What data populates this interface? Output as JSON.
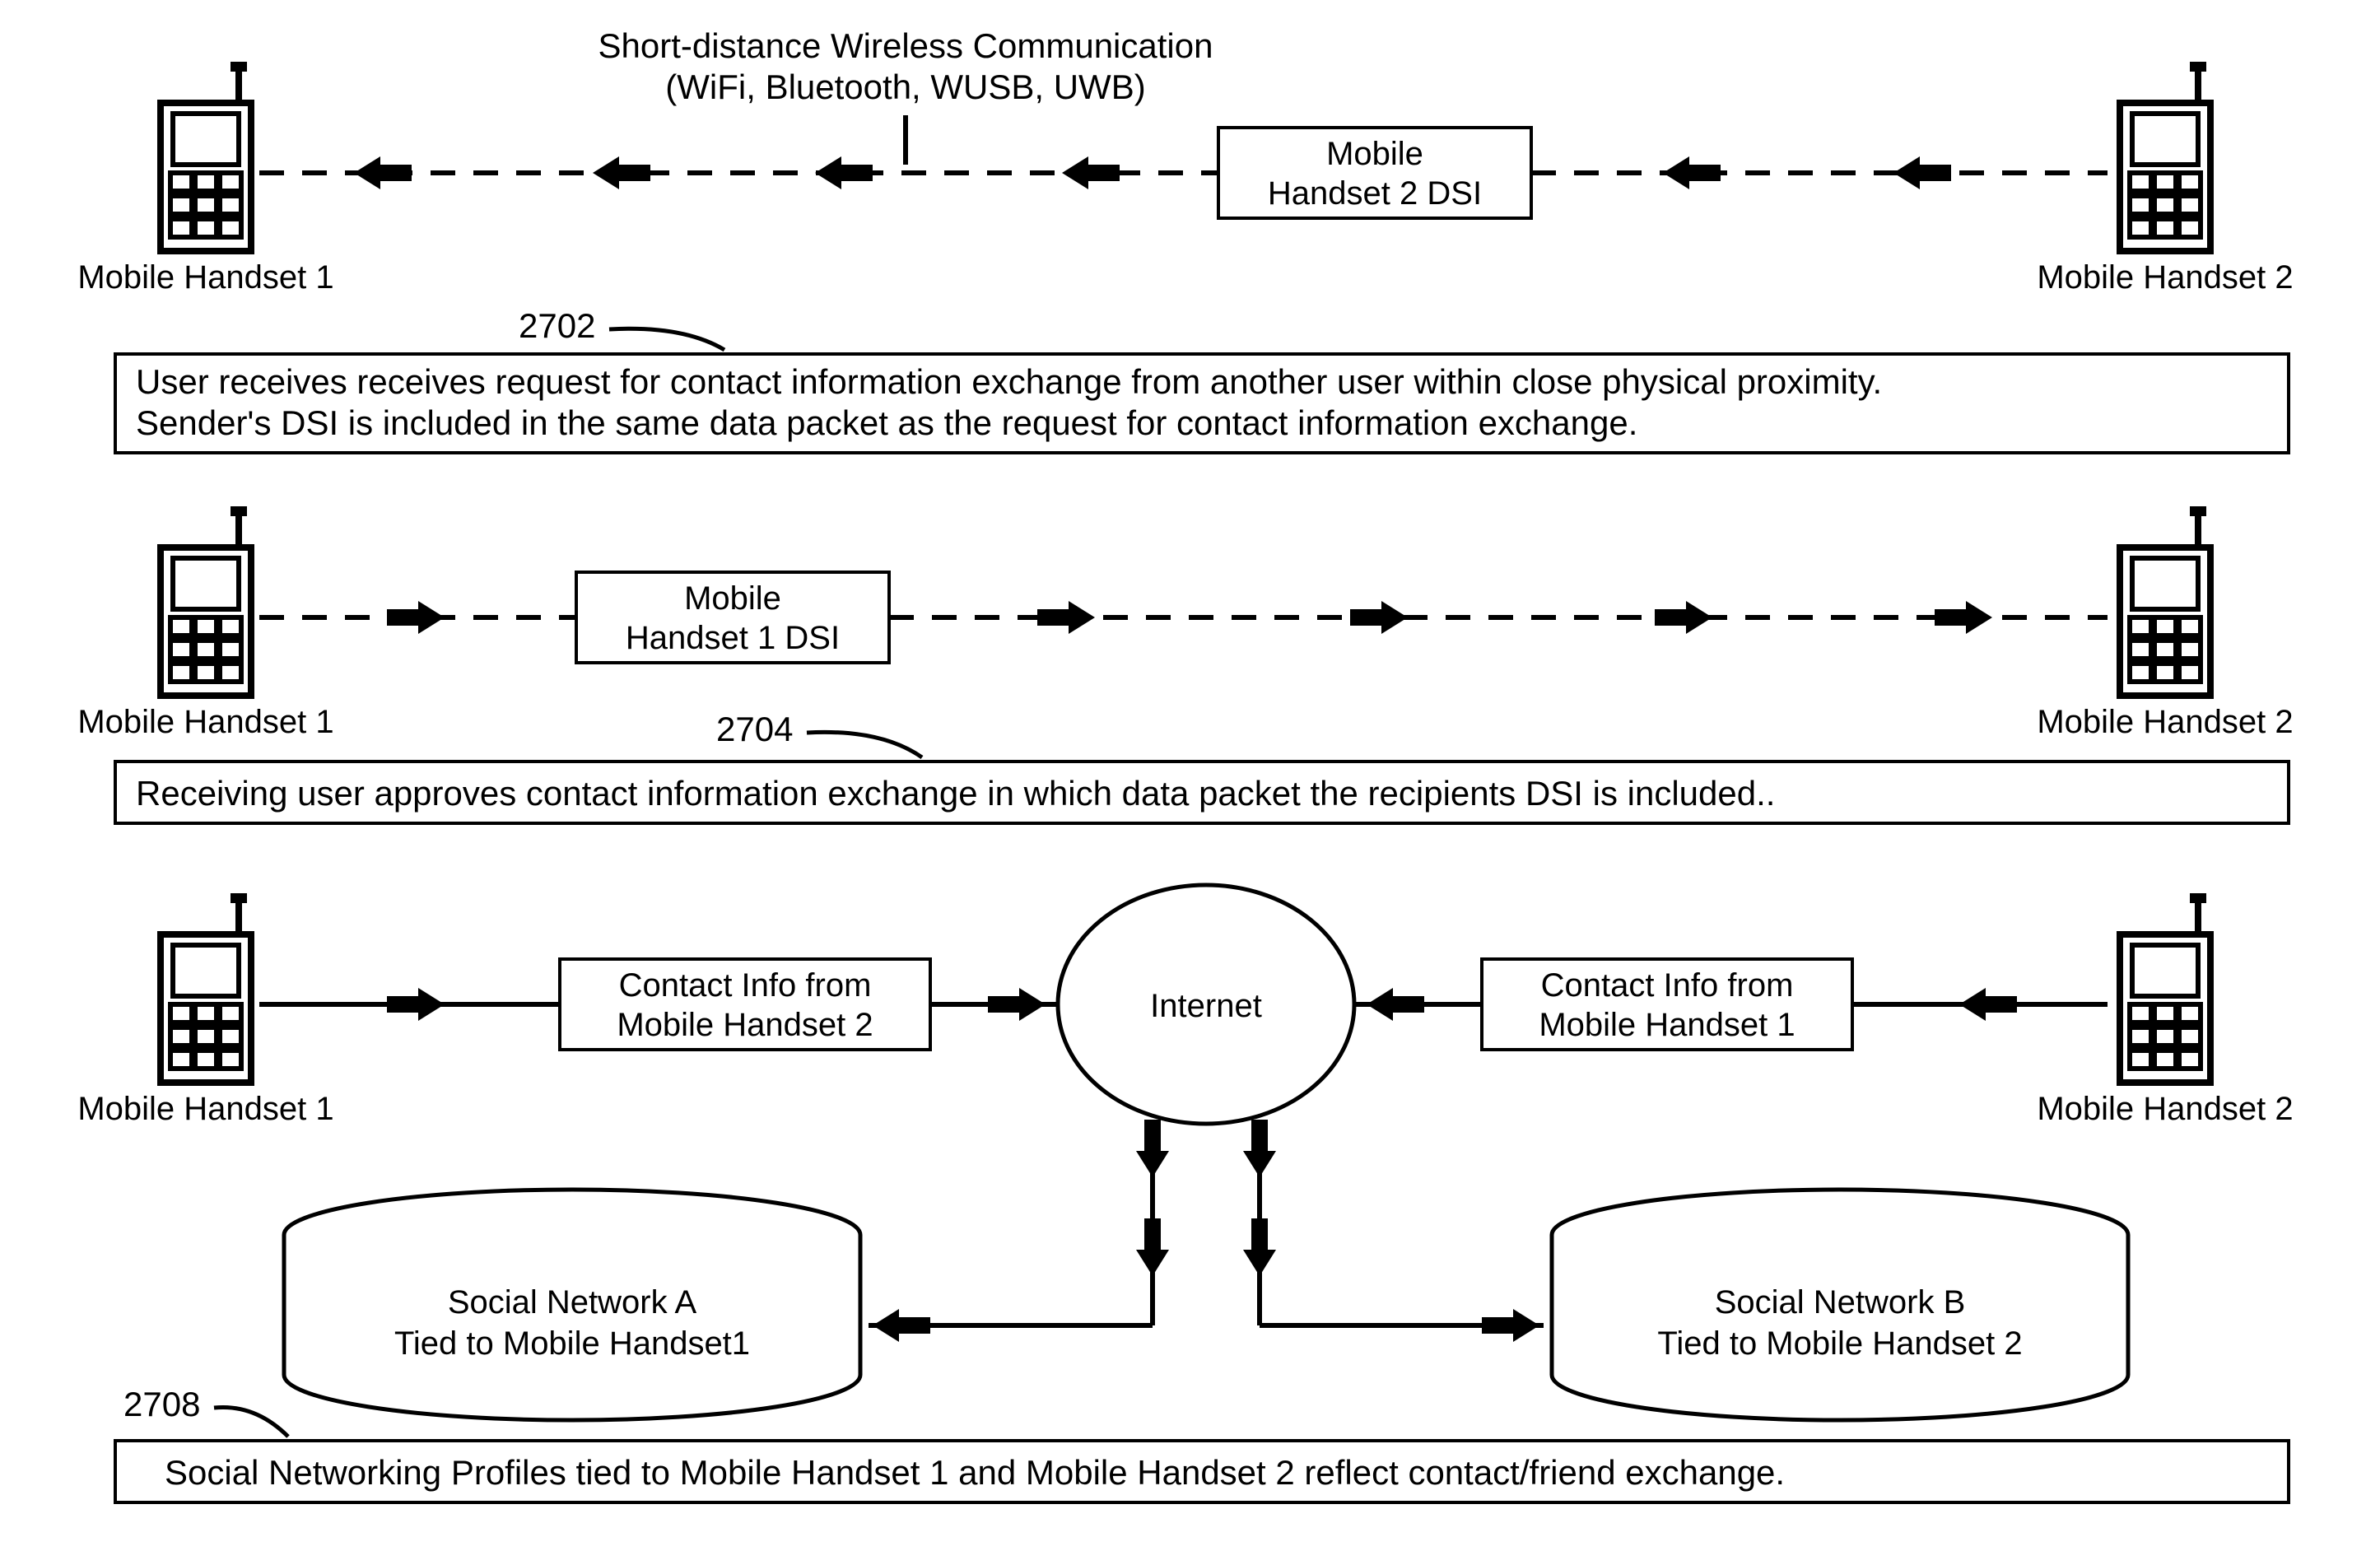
{
  "title_line1": "Short-distance Wireless Communication",
  "title_line2": "(WiFi, Bluetooth, WUSB, UWB)",
  "handset1_label": "Mobile Handset 1",
  "handset2_label": "Mobile Handset 2",
  "dsi2_line1": "Mobile",
  "dsi2_line2": "Handset 2 DSI",
  "dsi1_line1": "Mobile",
  "dsi1_line2": "Handset 1 DSI",
  "ref_2702": "2702",
  "ref_2704": "2704",
  "ref_2708": "2708",
  "step1_line1": "User receives receives request for contact information exchange from another user within close physical proximity.",
  "step1_line2": "Sender's DSI is included in the same data packet as the request for contact information exchange.",
  "step2": "Receiving user approves contact information exchange in which data packet the recipients DSI is included..",
  "contact_from2_line1": "Contact Info from",
  "contact_from2_line2": "Mobile Handset 2",
  "contact_from1_line1": "Contact Info from",
  "contact_from1_line2": "Mobile Handset 1",
  "internet": "Internet",
  "snA_line1": "Social Network A",
  "snA_line2": "Tied to Mobile Handset1",
  "snB_line1": "Social Network B",
  "snB_line2": "Tied to Mobile Handset 2",
  "step3": "Social Networking Profiles tied to Mobile Handset 1 and Mobile Handset 2 reflect contact/friend exchange."
}
